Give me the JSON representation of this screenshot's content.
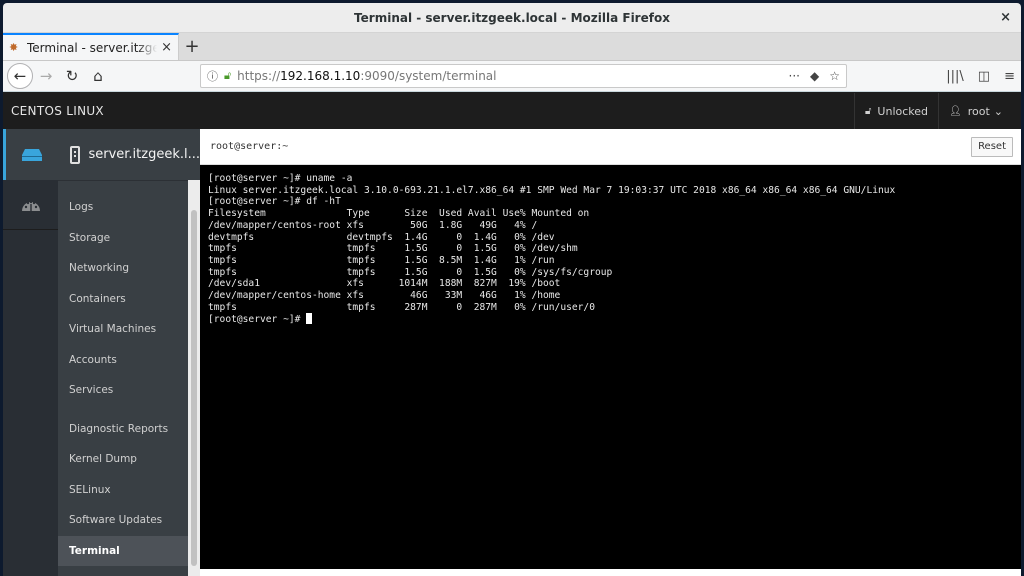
{
  "window": {
    "title": "Terminal - server.itzgeek.local - Mozilla Firefox",
    "close_glyph": "×"
  },
  "browser": {
    "tab_label": "Terminal - server.itzgeek.local",
    "tab_close": "×",
    "new_tab": "+",
    "url_prefix": "https://",
    "url_host": "192.168.1.10",
    "url_rest": ":9090/system/terminal",
    "back": "←",
    "forward": "→",
    "reload": "↻",
    "home": "⌂",
    "more": "···",
    "pocket": "◆",
    "bookmark": "☆",
    "library": "|||\\",
    "sidebar": "◫",
    "menu": "≡"
  },
  "header": {
    "brand": "CENTOS LINUX",
    "lock_label": "Unlocked",
    "user_label": "root",
    "user_caret": "⌄"
  },
  "host": {
    "name": "server.itzgeek.l..."
  },
  "menu": {
    "items": [
      {
        "label": "Logs"
      },
      {
        "label": "Storage"
      },
      {
        "label": "Networking"
      },
      {
        "label": "Containers"
      },
      {
        "label": "Virtual Machines"
      },
      {
        "label": "Accounts"
      },
      {
        "label": "Services"
      },
      {
        "label": "Diagnostic Reports"
      },
      {
        "label": "Kernel Dump"
      },
      {
        "label": "SELinux"
      },
      {
        "label": "Software Updates"
      },
      {
        "label": "Terminal",
        "active": true
      }
    ]
  },
  "terminal": {
    "title": "root@server:~",
    "reset_label": "Reset",
    "lines": [
      "[root@server ~]# uname -a",
      "Linux server.itzgeek.local 3.10.0-693.21.1.el7.x86_64 #1 SMP Wed Mar 7 19:03:37 UTC 2018 x86_64 x86_64 x86_64 GNU/Linux",
      "[root@server ~]# df -hT",
      "Filesystem              Type      Size  Used Avail Use% Mounted on",
      "/dev/mapper/centos-root xfs        50G  1.8G   49G   4% /",
      "devtmpfs                devtmpfs  1.4G     0  1.4G   0% /dev",
      "tmpfs                   tmpfs     1.5G     0  1.5G   0% /dev/shm",
      "tmpfs                   tmpfs     1.5G  8.5M  1.4G   1% /run",
      "tmpfs                   tmpfs     1.5G     0  1.5G   0% /sys/fs/cgroup",
      "/dev/sda1               xfs      1014M  188M  827M  19% /boot",
      "/dev/mapper/centos-home xfs        46G   33M   46G   1% /home",
      "tmpfs                   tmpfs     287M     0  287M   0% /run/user/0"
    ],
    "prompt": "[root@server ~]# "
  },
  "colors": {
    "accent": "#39a5dc",
    "header_bg": "#1d1d1d",
    "sidebar_bg": "#393f44",
    "terminal_bg": "#000000"
  }
}
